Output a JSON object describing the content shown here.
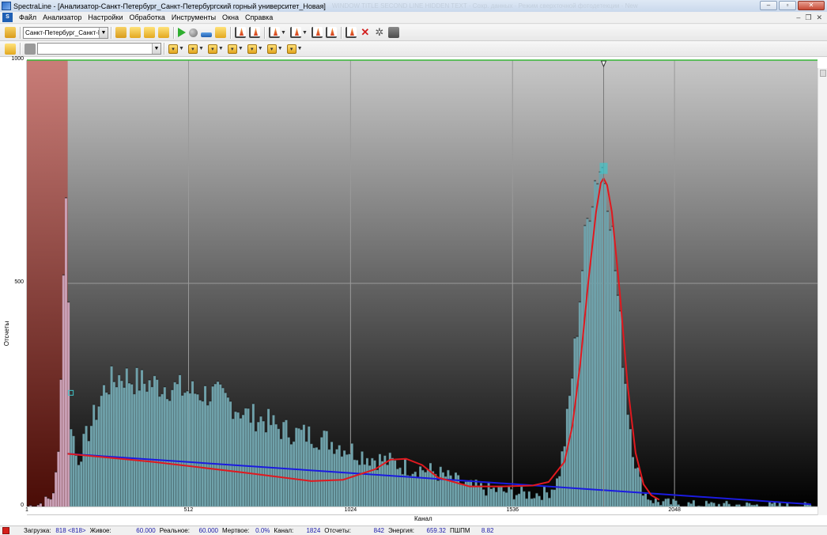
{
  "window": {
    "title": "SpectraLine - [Анализатор-Санкт-Петербург_Санкт-Петербургский горный университет_Новая]",
    "title_ghost": "WINDOW TITLE SECOND LINE HIDDEN TEXT · Сохр. данных · Режим сверхточной фотодетекции · New"
  },
  "menu": [
    "Файл",
    "Анализатор",
    "Настройки",
    "Обработка",
    "Инструменты",
    "Окна",
    "Справка"
  ],
  "toolbar": {
    "analyzer_combo": "Санкт-Петербург_Санкт-Петр...",
    "region_combo": ""
  },
  "chart_data": {
    "type": "bar",
    "title": "",
    "xlabel": "Канал",
    "ylabel": "Отсчеты",
    "xlim": [
      1,
      2500
    ],
    "ylim": [
      0,
      1000
    ],
    "x_ticks": [
      1,
      512,
      1024,
      1536,
      2048
    ],
    "y_ticks": [
      0,
      500,
      1000
    ],
    "grid": true,
    "marker_channel": 1824,
    "roi_region": [
      1,
      130
    ],
    "profile": {
      "x": [
        1,
        40,
        80,
        100,
        125,
        140,
        160,
        200,
        250,
        300,
        350,
        400,
        450,
        500,
        550,
        600,
        650,
        700,
        750,
        800,
        850,
        900,
        950,
        1000,
        1050,
        1100,
        1150,
        1200,
        1250,
        1300,
        1350,
        1400,
        1450,
        1500,
        1550,
        1600,
        1650,
        1680,
        1700,
        1720,
        1740,
        1760,
        1780,
        1800,
        1810,
        1820,
        1830,
        1840,
        1850,
        1860,
        1880,
        1900,
        1920,
        1940,
        1960,
        1980,
        2000,
        2050,
        2100,
        2200,
        2300,
        2400,
        2480
      ],
      "y": [
        0,
        5,
        20,
        90,
        720,
        200,
        100,
        175,
        270,
        295,
        280,
        275,
        270,
        260,
        255,
        250,
        230,
        205,
        195,
        175,
        165,
        160,
        150,
        135,
        120,
        108,
        100,
        90,
        85,
        75,
        60,
        45,
        40,
        35,
        30,
        28,
        32,
        60,
        140,
        260,
        400,
        560,
        680,
        740,
        760,
        760,
        740,
        700,
        630,
        540,
        380,
        230,
        120,
        55,
        25,
        15,
        10,
        7,
        5,
        4,
        3,
        2,
        2
      ]
    },
    "fit_curve": {
      "x": [
        130,
        400,
        700,
        900,
        1000,
        1100,
        1150,
        1200,
        1250,
        1300,
        1400,
        1500,
        1600,
        1650,
        1700,
        1725,
        1750,
        1775,
        1800,
        1815,
        1824,
        1835,
        1850,
        1875,
        1900,
        1925,
        1950,
        1975,
        2000
      ],
      "y": [
        118,
        100,
        75,
        57,
        60,
        83,
        105,
        107,
        93,
        65,
        45,
        45,
        47,
        55,
        100,
        180,
        320,
        500,
        660,
        725,
        735,
        720,
        660,
        480,
        270,
        120,
        50,
        25,
        15
      ]
    },
    "baseline": {
      "x": [
        130,
        2480
      ],
      "y": [
        118,
        5
      ]
    }
  },
  "status": {
    "load_label": "Загрузка:",
    "load_value": "818 <818>",
    "live_label": "Живое:",
    "live_value": "60.000",
    "real_label": "Реальное:",
    "real_value": "60.000",
    "dead_label": "Мертвое:",
    "dead_value": "0.0%",
    "channel_label": "Канал:",
    "channel_value": "1824",
    "counts_label": "Отсчеты:",
    "counts_value": "842",
    "energy_label": "Энергия:",
    "energy_value": "659.32",
    "fwhm_label": "ПШПМ",
    "fwhm_value": "8.82"
  },
  "colors": {
    "spectrum_fill": "#6fa1aa",
    "fit_line": "#e0191f",
    "baseline_line": "#1b1be0",
    "roi_fill": "#c97d78",
    "plot_top": "#c8c8c8",
    "plot_bottom": "#000000"
  }
}
